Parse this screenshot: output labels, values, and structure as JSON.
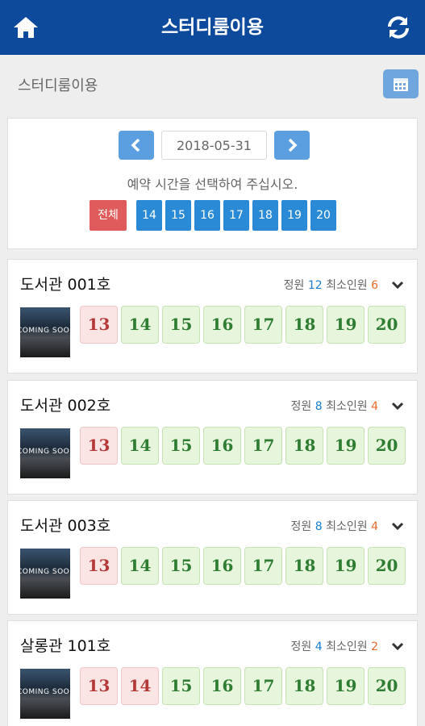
{
  "header": {
    "title": "스터디룸이용",
    "home_icon": "home-icon",
    "refresh_icon": "refresh-icon"
  },
  "page": {
    "title": "스터디룸이용",
    "calendar_icon": "calendar-icon"
  },
  "date_panel": {
    "date": "2018-05-31",
    "hint": "예약 시간을 선택하여 주십시오.",
    "all_label": "전체",
    "hours": [
      "14",
      "15",
      "16",
      "17",
      "18",
      "19",
      "20"
    ]
  },
  "rooms": [
    {
      "name": "도서관 001호",
      "capacity_label": "정원",
      "capacity": "12",
      "min_label": "최소인원",
      "min": "6",
      "thumb_text": "COMING SOON",
      "slots": [
        {
          "hour": "13",
          "available": false
        },
        {
          "hour": "14",
          "available": true
        },
        {
          "hour": "15",
          "available": true
        },
        {
          "hour": "16",
          "available": true
        },
        {
          "hour": "17",
          "available": true
        },
        {
          "hour": "18",
          "available": true
        },
        {
          "hour": "19",
          "available": true
        },
        {
          "hour": "20",
          "available": true
        }
      ]
    },
    {
      "name": "도서관 002호",
      "capacity_label": "정원",
      "capacity": "8",
      "min_label": "최소인원",
      "min": "4",
      "thumb_text": "COMING SOON",
      "slots": [
        {
          "hour": "13",
          "available": false
        },
        {
          "hour": "14",
          "available": true
        },
        {
          "hour": "15",
          "available": true
        },
        {
          "hour": "16",
          "available": true
        },
        {
          "hour": "17",
          "available": true
        },
        {
          "hour": "18",
          "available": true
        },
        {
          "hour": "19",
          "available": true
        },
        {
          "hour": "20",
          "available": true
        }
      ]
    },
    {
      "name": "도서관 003호",
      "capacity_label": "정원",
      "capacity": "8",
      "min_label": "최소인원",
      "min": "4",
      "thumb_text": "COMING SOON",
      "slots": [
        {
          "hour": "13",
          "available": false
        },
        {
          "hour": "14",
          "available": true
        },
        {
          "hour": "15",
          "available": true
        },
        {
          "hour": "16",
          "available": true
        },
        {
          "hour": "17",
          "available": true
        },
        {
          "hour": "18",
          "available": true
        },
        {
          "hour": "19",
          "available": true
        },
        {
          "hour": "20",
          "available": true
        }
      ]
    },
    {
      "name": "살롱관 101호",
      "capacity_label": "정원",
      "capacity": "4",
      "min_label": "최소인원",
      "min": "2",
      "thumb_text": "COMING SOON",
      "slots": [
        {
          "hour": "13",
          "available": false
        },
        {
          "hour": "14",
          "available": false
        },
        {
          "hour": "15",
          "available": true
        },
        {
          "hour": "16",
          "available": true
        },
        {
          "hour": "17",
          "available": true
        },
        {
          "hour": "18",
          "available": true
        },
        {
          "hour": "19",
          "available": true
        },
        {
          "hour": "20",
          "available": true
        }
      ]
    }
  ]
}
